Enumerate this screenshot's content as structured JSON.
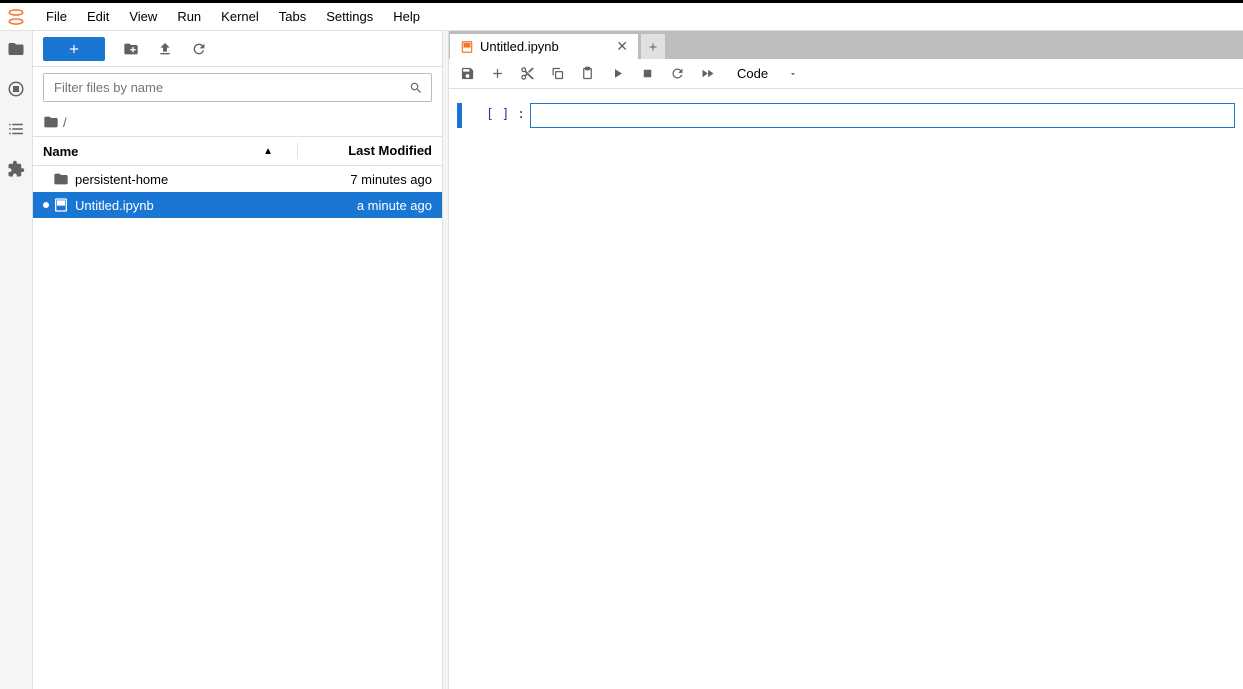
{
  "menu": {
    "file": "File",
    "edit": "Edit",
    "view": "View",
    "run": "Run",
    "kernel": "Kernel",
    "tabs": "Tabs",
    "settings": "Settings",
    "help": "Help"
  },
  "filebrowser": {
    "filter_placeholder": "Filter files by name",
    "breadcrumb_root": "/",
    "header_name": "Name",
    "header_modified": "Last Modified",
    "items": [
      {
        "name": "persistent-home",
        "modified": "7 minutes ago",
        "type": "folder",
        "selected": false,
        "running": false
      },
      {
        "name": "Untitled.ipynb",
        "modified": "a minute ago",
        "type": "notebook",
        "selected": true,
        "running": true
      }
    ]
  },
  "tab": {
    "title": "Untitled.ipynb"
  },
  "toolbar": {
    "cell_type": "Code"
  },
  "cell": {
    "prompt": "[  ] :",
    "content": ""
  }
}
